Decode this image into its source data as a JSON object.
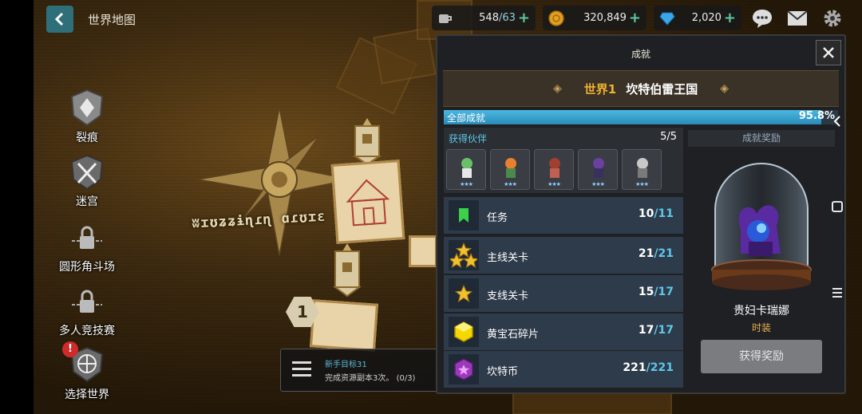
{
  "header": {
    "title": "世界地图"
  },
  "currencies": [
    {
      "name": "stamina",
      "icon": "coffee-cup-icon",
      "value": "548",
      "max": "/63"
    },
    {
      "name": "gold",
      "icon": "gold-coin-icon",
      "value": "320,849"
    },
    {
      "name": "gems",
      "icon": "diamond-icon",
      "value": "2,020"
    }
  ],
  "left_menu": [
    {
      "label": "裂痕",
      "icon": "rift-shield-icon"
    },
    {
      "label": "迷宫",
      "icon": "crossed-axes-icon"
    },
    {
      "label": "圆形角斗场",
      "icon": "locked-arena-icon"
    },
    {
      "label": "多人竞技赛",
      "icon": "locked-pvp-icon"
    },
    {
      "label": "选择世界",
      "icon": "world-select-icon",
      "alert": "!"
    }
  ],
  "map": {
    "stage_number": "1",
    "newbie_goal": {
      "title": "新手目标31",
      "desc": "完成资源副本3次。",
      "progress": "(0/3)"
    }
  },
  "panel": {
    "title": "成就",
    "world_label": "世界1",
    "world_name": "坎特伯雷王国",
    "overall_label": "全部成就",
    "overall_pct": "95.8%",
    "overall_fraction": 0.958,
    "companions": {
      "label": "获得伙伴",
      "count": "5/5"
    },
    "rows": [
      {
        "label": "任务",
        "done": "10",
        "total": "/11",
        "icon": "green-bookmark-icon"
      },
      {
        "label": "主线关卡",
        "done": "21",
        "total": "/21",
        "icon": "three-stars-icon"
      },
      {
        "label": "支线关卡",
        "done": "15",
        "total": "/17",
        "icon": "star-icon"
      },
      {
        "label": "黄宝石碎片",
        "done": "17",
        "total": "/17",
        "icon": "yellow-gem-icon"
      },
      {
        "label": "坎特币",
        "done": "221",
        "total": "/221",
        "icon": "purple-coin-icon"
      }
    ],
    "reward": {
      "header": "成就奖励",
      "name": "贵妇卡瑞娜",
      "type": "时装",
      "button": "获得奖励"
    }
  },
  "colors": {
    "accent": "#5cc8e8",
    "gold": "#f0b030",
    "progress": "#4ab8e0"
  }
}
